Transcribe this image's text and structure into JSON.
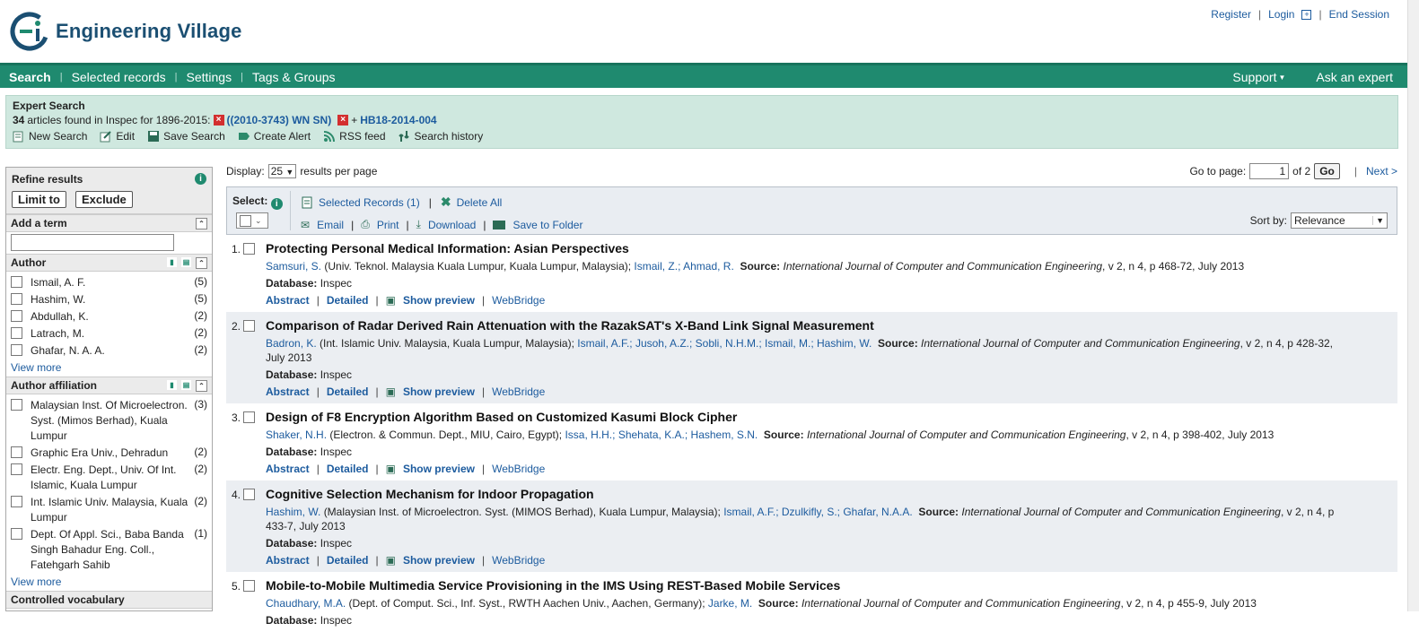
{
  "brand": {
    "name": "Engineering Village",
    "color": "#1b4f72"
  },
  "toplinks": [
    "Register",
    "Login",
    "End Session"
  ],
  "nav": {
    "items": [
      "Search",
      "Selected records",
      "Settings",
      "Tags & Groups"
    ],
    "right": [
      "Support",
      "Ask an expert"
    ],
    "color": "#1f8a6f"
  },
  "search": {
    "title": "Expert Search",
    "count": "34",
    "found_text": "articles found in Inspec for 1896-2015:",
    "term1": "((2010-3743) WN SN)",
    "term2": "HB18-2014-004",
    "tools": [
      "New Search",
      "Edit",
      "Save Search",
      "Create Alert",
      "RSS feed",
      "Search history"
    ]
  },
  "refine": {
    "title": "Refine results",
    "limit_label": "Limit to",
    "exclude_label": "Exclude",
    "add_term_label": "Add a term",
    "add_term_value": "",
    "view_more": "View more",
    "author": {
      "title": "Author",
      "items": [
        {
          "label": "Ismail, A. F.",
          "count": "(5)"
        },
        {
          "label": "Hashim, W.",
          "count": "(5)"
        },
        {
          "label": "Abdullah, K.",
          "count": "(2)"
        },
        {
          "label": "Latrach, M.",
          "count": "(2)"
        },
        {
          "label": "Ghafar, N. A. A.",
          "count": "(2)"
        }
      ]
    },
    "affiliation": {
      "title": "Author affiliation",
      "items": [
        {
          "label": "Malaysian Inst. Of Microelectron. Syst. (Mimos Berhad), Kuala Lumpur",
          "count": "(3)"
        },
        {
          "label": "Graphic Era Univ., Dehradun",
          "count": "(2)"
        },
        {
          "label": "Electr. Eng. Dept., Univ. Of Int. Islamic, Kuala Lumpur",
          "count": "(2)"
        },
        {
          "label": "Int. Islamic Univ. Malaysia, Kuala Lumpur",
          "count": "(2)"
        },
        {
          "label": "Dept. Of Appl. Sci., Baba Banda Singh Bahadur Eng. Coll., Fatehgarh Sahib",
          "count": "(1)"
        }
      ]
    },
    "controlled_vocab": "Controlled vocabulary"
  },
  "display": {
    "label": "Display:",
    "value": "25",
    "suffix": "results per page",
    "goto_label": "Go to page:",
    "page": "1",
    "of_label": "of 2",
    "go_label": "Go",
    "next_label": "Next >"
  },
  "toolbar": {
    "select_label": "Select:",
    "selected_records": "Selected Records (1)",
    "delete_all": "Delete All",
    "email": "Email",
    "print": "Print",
    "download": "Download",
    "save_folder": "Save to Folder",
    "sort_label": "Sort by:",
    "sort_value": "Relevance"
  },
  "labels": {
    "source": "Source:",
    "database": "Database:",
    "abstract": "Abstract",
    "detailed": "Detailed",
    "show_preview": "Show preview",
    "webbridge": "WebBridge"
  },
  "records": [
    {
      "num": "1.",
      "title": "Protecting Personal Medical Information: Asian Perspectives",
      "first_author": "Samsuri, S.",
      "affil": "(Univ. Teknol. Malaysia Kuala Lumpur, Kuala Lumpur, Malaysia);",
      "coauthors": "Ismail, Z.; Ahmad, R.",
      "journal": "International Journal of Computer and Communication Engineering",
      "citation": ", v 2, n 4, p 468-72, July 2013",
      "database": "Inspec"
    },
    {
      "num": "2.",
      "title": "Comparison of Radar Derived Rain Attenuation with the RazakSAT's X-Band Link Signal Measurement",
      "first_author": "Badron, K.",
      "affil": "(Int. Islamic Univ. Malaysia, Kuala Lumpur, Malaysia);",
      "coauthors": "Ismail, A.F.; Jusoh, A.Z.; Sobli, N.H.M.; Ismail, M.; Hashim, W.",
      "journal": "International Journal of Computer and Communication Engineering",
      "citation": ", v 2, n 4, p 428-32, July 2013",
      "database": "Inspec"
    },
    {
      "num": "3.",
      "title": "Design of F8 Encryption Algorithm Based on Customized Kasumi Block Cipher",
      "first_author": "Shaker, N.H.",
      "affil": "(Electron. & Commun. Dept., MIU, Cairo, Egypt);",
      "coauthors": "Issa, H.H.; Shehata, K.A.; Hashem, S.N.",
      "journal": "International Journal of Computer and Communication Engineering",
      "citation": ", v 2, n 4, p 398-402, July 2013",
      "database": "Inspec"
    },
    {
      "num": "4.",
      "title": "Cognitive Selection Mechanism for Indoor Propagation",
      "first_author": "Hashim, W.",
      "affil": "(Malaysian Inst. of Microelectron. Syst. (MIMOS Berhad), Kuala Lumpur, Malaysia);",
      "coauthors": "Ismail, A.F.; Dzulkifly, S.; Ghafar, N.A.A.",
      "journal": "International Journal of Computer and Communication Engineering",
      "citation": ", v 2, n 4, p 433-7, July 2013",
      "database": "Inspec"
    },
    {
      "num": "5.",
      "title": "Mobile-to-Mobile Multimedia Service Provisioning in the IMS Using REST-Based Mobile Services",
      "first_author": "Chaudhary, M.A.",
      "affil": "(Dept. of Comput. Sci., Inf. Syst., RWTH Aachen Univ., Aachen, Germany);",
      "coauthors": "Jarke, M.",
      "journal": "International Journal of Computer and Communication Engineering",
      "citation": ", v 2, n 4, p 455-9, July 2013",
      "database": "Inspec"
    }
  ]
}
